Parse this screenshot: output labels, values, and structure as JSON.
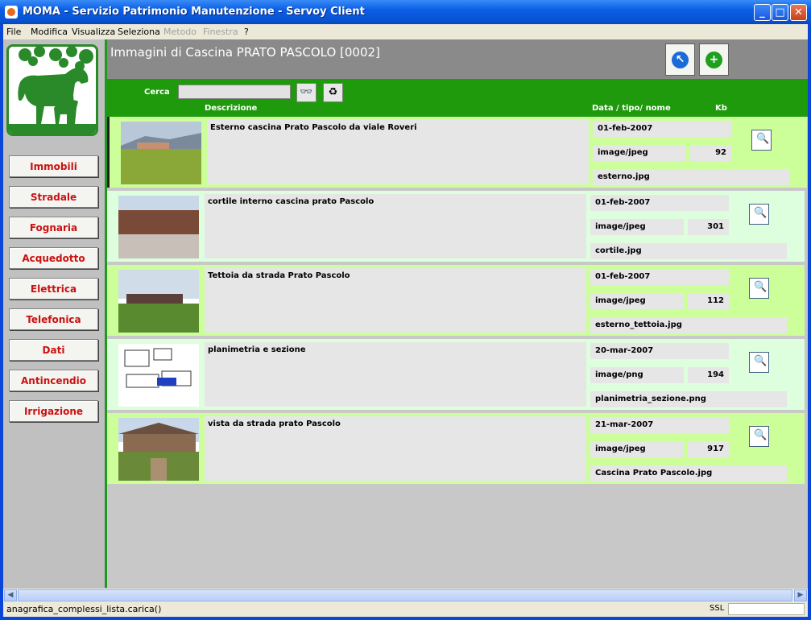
{
  "window": {
    "title": "MOMA - Servizio Patrimonio Manutenzione - Servoy Client"
  },
  "menu": [
    "File",
    "Modifica",
    "Visualizza",
    "Seleziona",
    "Metodo",
    "Finestra",
    "?"
  ],
  "menu_disabled": [
    "Metodo",
    "Finestra"
  ],
  "nav": [
    "Immobili",
    "Stradale",
    "Fognaria",
    "Acquedotto",
    "Elettrica",
    "Telefonica",
    "Dati",
    "Antincendio",
    "Irrigazione"
  ],
  "header": {
    "title": "Immagini di Cascina PRATO PASCOLO [0002]",
    "back_icon": "arrow-back-icon",
    "add_icon": "plus-icon"
  },
  "search": {
    "label": "Cerca",
    "value": ""
  },
  "columns": {
    "description": "Descrizione",
    "meta": "Data / tipo/ nome",
    "kb": "Kb"
  },
  "rows": [
    {
      "description": "Esterno cascina Prato Pascolo da viale Roveri",
      "date": "01-feb-2007",
      "type": "image/jpeg",
      "kb": "92",
      "name": "esterno.jpg"
    },
    {
      "description": "cortile interno cascina prato Pascolo",
      "date": "01-feb-2007",
      "type": "image/jpeg",
      "kb": "301",
      "name": "cortile.jpg"
    },
    {
      "description": "Tettoia da strada Prato Pascolo",
      "date": "01-feb-2007",
      "type": "image/jpeg",
      "kb": "112",
      "name": "esterno_tettoia.jpg"
    },
    {
      "description": "planimetria e sezione",
      "date": "20-mar-2007",
      "type": "image/png",
      "kb": "194",
      "name": "planimetria_sezione.png"
    },
    {
      "description": "vista da strada prato Pascolo",
      "date": "21-mar-2007",
      "type": "image/jpeg",
      "kb": "917",
      "name": "Cascina Prato Pascolo.jpg"
    }
  ],
  "status": {
    "text": "anagrafica_complessi_lista.carica()",
    "ssl": "SSL"
  },
  "colors": {
    "green": "#1f9a0c",
    "row_odd": "#ccff99",
    "row_even": "#ddffdd",
    "nav_text": "#cc1010"
  }
}
